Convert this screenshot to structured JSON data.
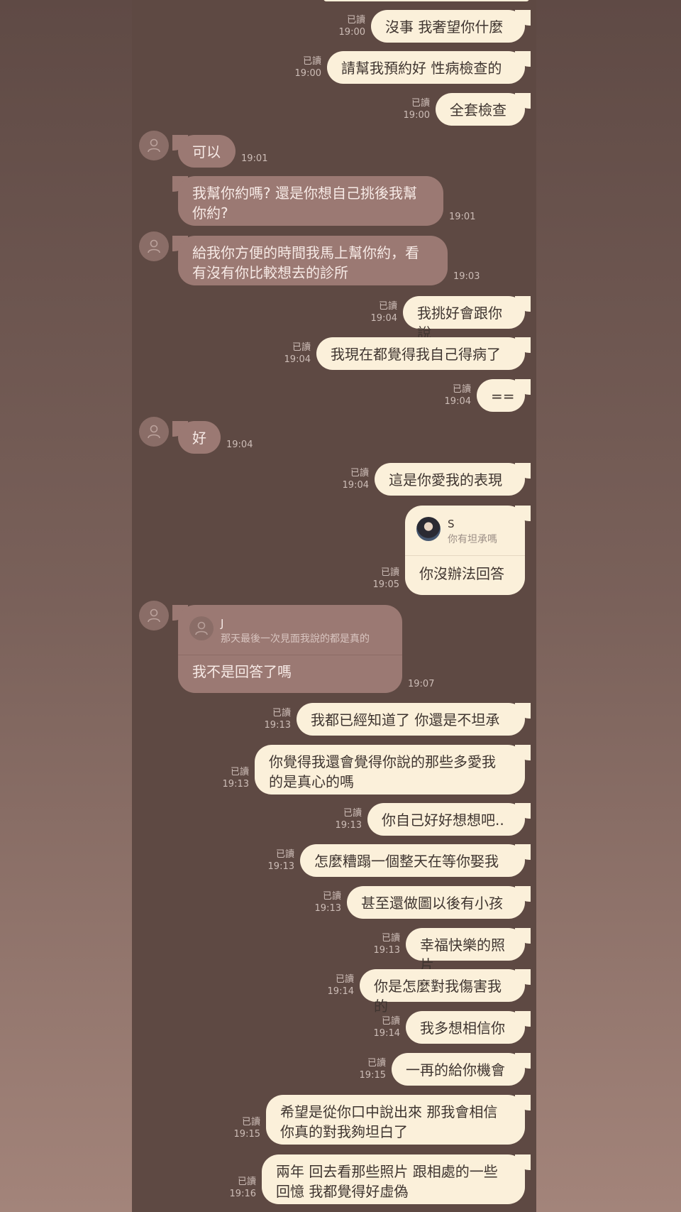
{
  "read_label": "已讀",
  "messages": [
    {
      "side": "out",
      "text": "沒事 我奢望你什麼",
      "time": "19:00"
    },
    {
      "side": "out",
      "text": "請幫我預約好 性病檢查的",
      "time": "19:00"
    },
    {
      "side": "out",
      "text": "全套檢查",
      "time": "19:00"
    },
    {
      "side": "in",
      "text": "可以",
      "time": "19:01"
    },
    {
      "side": "in",
      "text": "我幫你約嗎? 還是你想自己挑後我幫\n你約?",
      "time": "19:01"
    },
    {
      "side": "in",
      "text": "給我你方便的時間我馬上幫你約，看\n有沒有你比較想去的診所",
      "time": "19:03"
    },
    {
      "side": "out",
      "text": "我挑好會跟你說",
      "time": "19:04"
    },
    {
      "side": "out",
      "text": "我現在都覺得我自己得病了",
      "time": "19:04"
    },
    {
      "side": "out",
      "text": "==",
      "time": "19:04"
    },
    {
      "side": "in",
      "text": "好",
      "time": "19:04"
    },
    {
      "side": "out",
      "text": "這是你愛我的表現",
      "time": "19:04"
    },
    {
      "side": "out",
      "text": "你沒辦法回答",
      "time": "19:05",
      "quote": {
        "name": "S",
        "text": "你有坦承嗎"
      }
    },
    {
      "side": "in",
      "text": "我不是回答了嗎",
      "time": "19:07",
      "quote": {
        "name": "J",
        "text": "那天最後一次見面我說的都是真的"
      }
    },
    {
      "side": "out",
      "text": "我都已經知道了 你還是不坦承",
      "time": "19:13"
    },
    {
      "side": "out",
      "text": "你覺得我還會覺得你說的那些多愛我\n的是真心的嗎",
      "time": "19:13"
    },
    {
      "side": "out",
      "text": "你自己好好想想吧..",
      "time": "19:13"
    },
    {
      "side": "out",
      "text": "怎麼糟蹋一個整天在等你娶我",
      "time": "19:13"
    },
    {
      "side": "out",
      "text": "甚至還做圖以後有小孩",
      "time": "19:13"
    },
    {
      "side": "out",
      "text": "幸福快樂的照片",
      "time": "19:13"
    },
    {
      "side": "out",
      "text": "你是怎麼對我傷害我的",
      "time": "19:14"
    },
    {
      "side": "out",
      "text": "我多想相信你",
      "time": "19:14"
    },
    {
      "side": "out",
      "text": "一再的給你機會",
      "time": "19:15"
    },
    {
      "side": "out",
      "text": "希望是從你口中說出來 那我會相信\n你真的對我夠坦白了",
      "time": "19:15"
    },
    {
      "side": "out",
      "text": "兩年 回去看那些照片 跟相處的一些\n回憶 我都覺得好虛偽",
      "time": "19:16"
    }
  ]
}
